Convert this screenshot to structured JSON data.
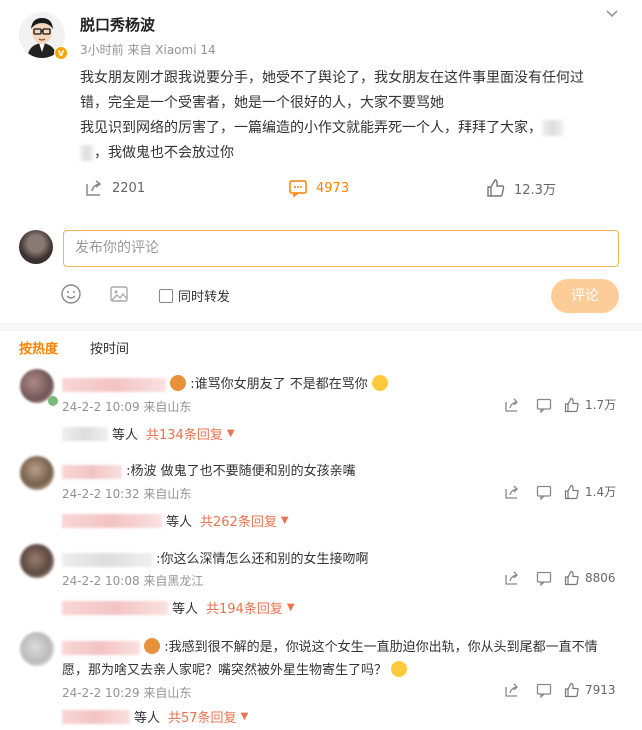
{
  "post": {
    "author": "脱口秀杨波",
    "meta": "3小时前  来自 Xiaomi 14",
    "verified_mark": "v",
    "text_lines": [
      "我女朋友刚才跟我说要分手，她受不了舆论了，我女朋友在这件事里面没有任何过",
      "错，完全是一个受害者，她是一个很好的人，大家不要骂她",
      "我见识到网络的厉害了，一篇编造的小作文就能弄死一个人，拜拜了大家，",
      "，我做鬼也不会放过你"
    ],
    "actions": {
      "share": "2201",
      "comment": "4973",
      "like": "12.3万"
    }
  },
  "composer": {
    "placeholder": "发布你的评论",
    "repost_label": "同时转发",
    "submit_label": "评论"
  },
  "sort": {
    "hot": "按热度",
    "time": "按时间"
  },
  "comments": [
    {
      "text": ":谁骂你女朋友了 不是都在骂你",
      "meta": "24-2-2 10:09 来自山东",
      "likes": "1.7万",
      "reply_suffix": "等人",
      "reply_count": "共134条回复"
    },
    {
      "text": ":杨波 做鬼了也不要随便和别的女孩亲嘴",
      "meta": "24-2-2 10:32 来自山东",
      "likes": "1.4万",
      "reply_suffix": "等人",
      "reply_count": "共262条回复"
    },
    {
      "text": ":你这么深情怎么还和别的女生接吻啊",
      "meta": "24-2-2 10:08 来自黑龙江",
      "likes": "8806",
      "reply_suffix": "等人",
      "reply_count": "共194条回复"
    },
    {
      "text_line1": ":我感到很不解的是，你说这个女生一直肋迫你出轨，你从头到尾都一直不情",
      "text_line2": "愿，那为啥又去亲人家呢？嘴突然被外星生物寄生了吗？",
      "meta": "24-2-2 10:29 来自山东",
      "likes": "7913",
      "reply_suffix": "等人",
      "reply_count": "共57条回复"
    }
  ],
  "colors": {
    "accent": "#ff8200",
    "reply_count": "#eb7350",
    "submit_bg": "#fccd99",
    "input_border": "#f4b35a"
  }
}
